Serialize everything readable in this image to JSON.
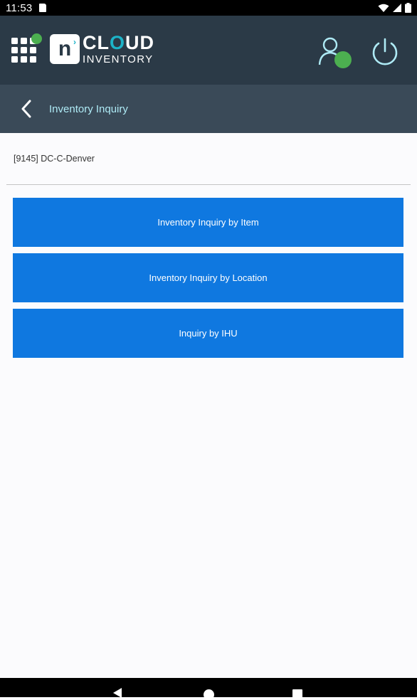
{
  "status_bar": {
    "time": "11:53",
    "icons": [
      "sd-card-icon",
      "wifi-icon",
      "signal-icon",
      "battery-icon"
    ]
  },
  "app_bar": {
    "logo_cloud_pre": "CL",
    "logo_cloud_o": "O",
    "logo_cloud_post": "UD",
    "logo_inventory": "INVENTORY",
    "logo_mark": "n",
    "notification_color": "#4caf50",
    "status_color": "#4caf50",
    "accent_color": "#1cb3c8"
  },
  "title_bar": {
    "title": "Inventory Inquiry"
  },
  "main": {
    "location": "[9145] DC-C-Denver",
    "buttons": [
      {
        "label": "Inventory Inquiry by Item"
      },
      {
        "label": "Inventory Inquiry by Location"
      },
      {
        "label": "Inquiry by IHU"
      }
    ],
    "button_color": "#0f78e0"
  },
  "nav_bar": {
    "icons": [
      "back-nav-icon",
      "home-nav-icon",
      "recents-nav-icon"
    ]
  }
}
